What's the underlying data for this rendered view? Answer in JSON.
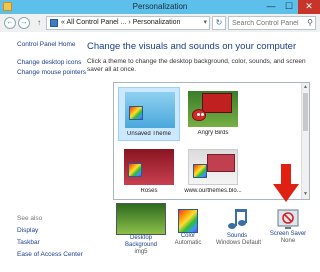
{
  "window": {
    "title": "Personalization",
    "minimize_glyph": "—",
    "maximize_glyph": "☐",
    "close_glyph": "✕"
  },
  "address": {
    "back_glyph": "←",
    "forward_glyph": "→",
    "up_glyph": "↑",
    "breadcrumb": "« All Control Panel ...  ›  Personalization",
    "dropdown_glyph": "▾",
    "refresh_glyph": "↻",
    "search_placeholder": "Search Control Panel",
    "search_glyph": "⚲"
  },
  "sidebar": {
    "items": [
      {
        "label": "Control Panel Home"
      },
      {
        "label": "Change desktop icons"
      },
      {
        "label": "Change mouse pointers"
      }
    ],
    "see_also_title": "See also",
    "see_also": [
      {
        "label": "Display"
      },
      {
        "label": "Taskbar"
      },
      {
        "label": "Ease of Access Center"
      }
    ]
  },
  "main": {
    "heading": "Change the visuals and sounds on your computer",
    "description": "Click a theme to change the desktop background, color, sounds, and screen saver all at once."
  },
  "themes": [
    {
      "label": "Unsaved Theme",
      "selected": true,
      "icon": "palette-icon"
    },
    {
      "label": "Angry Birds",
      "selected": false,
      "icon": "angry-bird-icon"
    },
    {
      "label": "Roses",
      "selected": false,
      "icon": "palette-icon"
    },
    {
      "label": "www.ourthemes.blo...",
      "selected": false,
      "icon": "palette-icon"
    }
  ],
  "scrollbar": {
    "up_glyph": "▲",
    "down_glyph": "▼"
  },
  "bottom": {
    "desktop_background": {
      "label_line1": "Desktop",
      "label_line2": "Background",
      "value": "img5"
    },
    "color": {
      "label": "Color",
      "value": "Automatic"
    },
    "sounds": {
      "label": "Sounds",
      "value": "Windows Default"
    },
    "screen_saver": {
      "label": "Screen Saver",
      "value": "None"
    }
  },
  "colors": {
    "titlebar": "#5cc0ea",
    "link": "#1a3e8c",
    "selection": "#cce8ff",
    "close_button": "#c7352a",
    "annotation_arrow": "#e02010"
  }
}
